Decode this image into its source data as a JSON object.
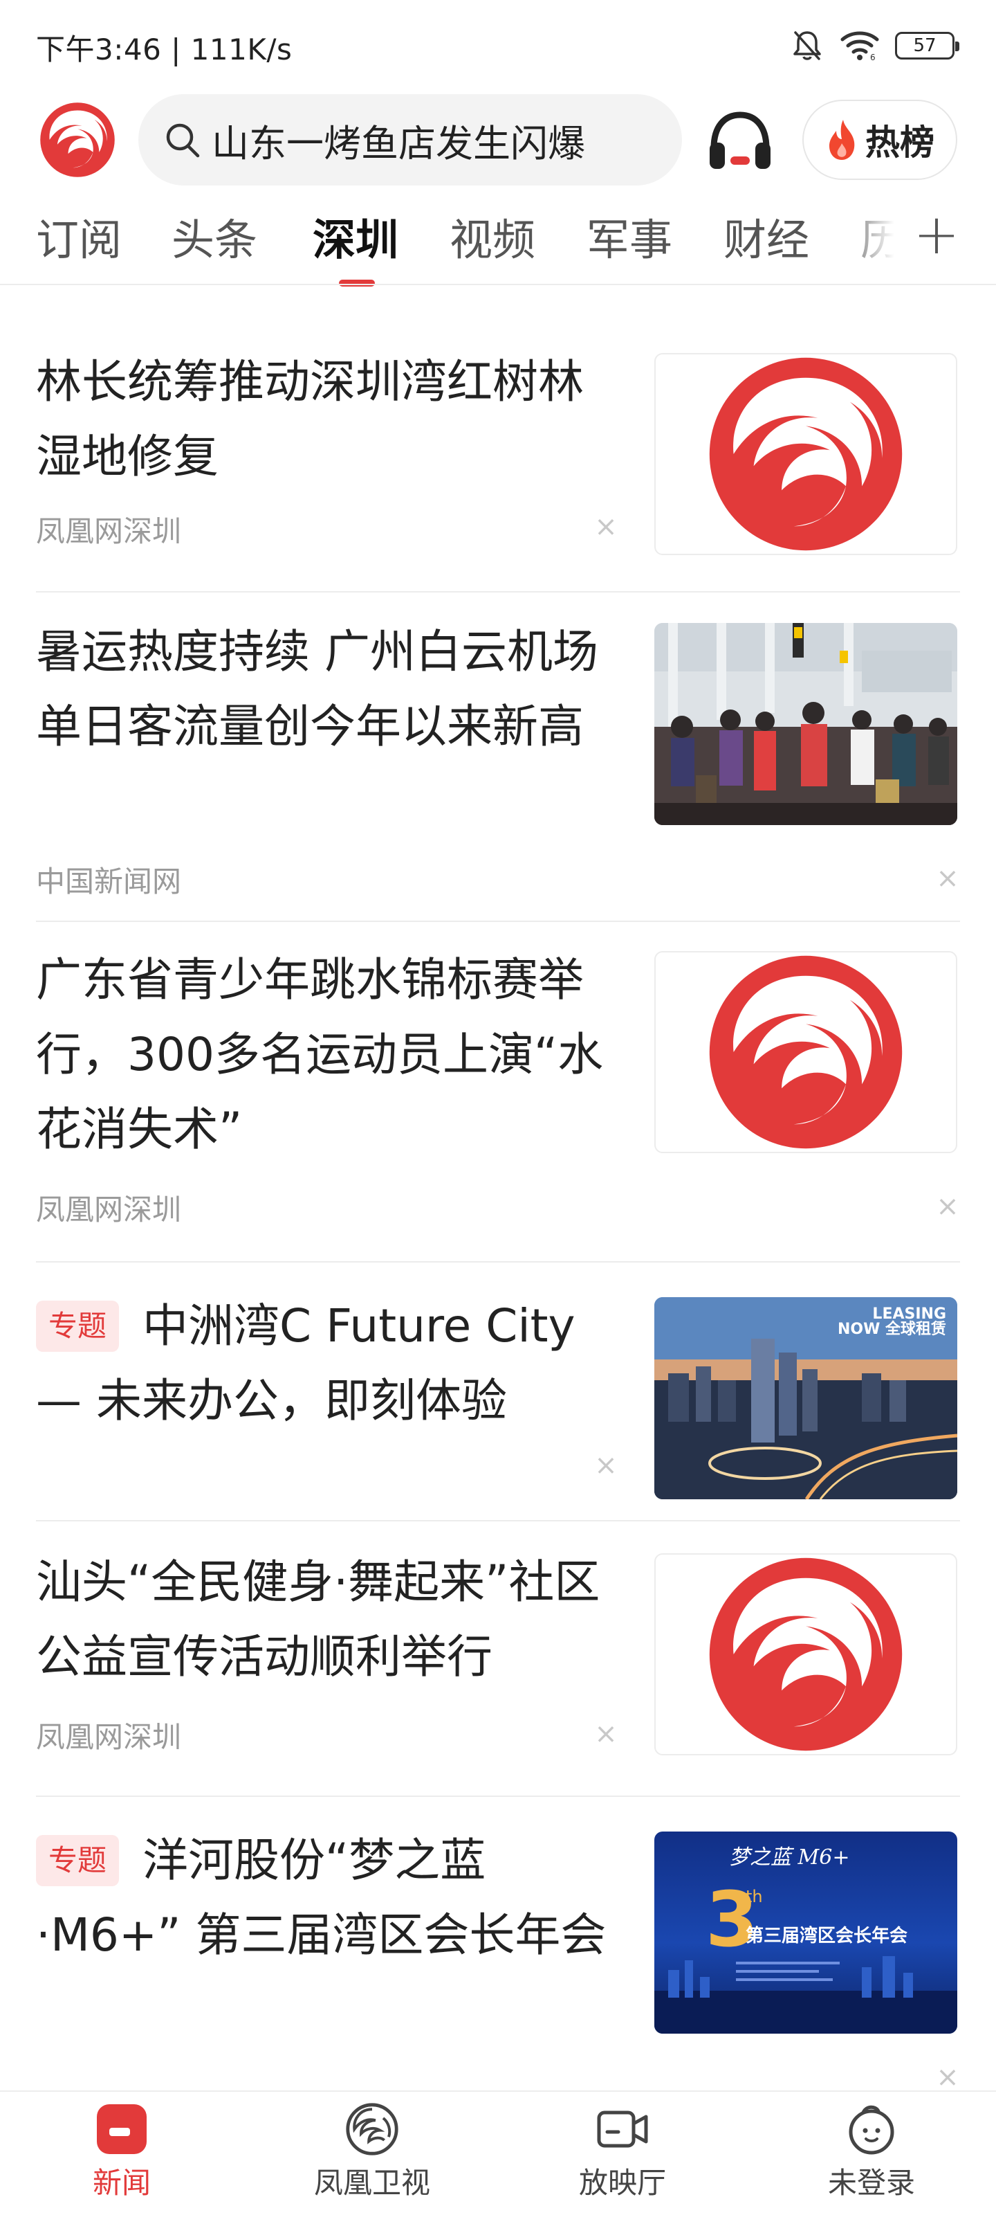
{
  "status_bar": {
    "time_and_speed": "下午3:46 | 111K/s",
    "battery_level": "57"
  },
  "header": {
    "logo_icon": "phoenix-logo-icon",
    "search_query": "山东一烤鱼店发生闪爆",
    "search_icon": "search-icon",
    "audio_icon": "headphones-icon",
    "hotlist_label": "热榜",
    "hotlist_icon": "flame-icon"
  },
  "tabs": {
    "items": [
      {
        "label": "订阅"
      },
      {
        "label": "头条"
      },
      {
        "label": "深圳"
      },
      {
        "label": "视频"
      },
      {
        "label": "军事"
      },
      {
        "label": "财经"
      },
      {
        "label": "历"
      }
    ],
    "active_label": "深圳",
    "add_label": "+"
  },
  "feed": {
    "items": [
      {
        "title": "林长统筹推动深圳湾红树林湿地修复",
        "source": "凤凰网深圳",
        "thumbnail": "phoenix-logo",
        "badge": ""
      },
      {
        "title": "暑运热度持续 广州白云机场单日客流量创今年以来新高",
        "source": "中国新闻网",
        "thumbnail": "airport-photo",
        "badge": ""
      },
      {
        "title": "广东省青少年跳水锦标赛举行，300多名运动员上演“水花消失术”",
        "source": "凤凰网深圳",
        "thumbnail": "phoenix-logo",
        "badge": ""
      },
      {
        "title": "中洲湾C Future City — 未来办公，即刻体验",
        "source": "",
        "thumbnail": "city-photo",
        "badge": "专题"
      },
      {
        "title": "汕头“全民健身·舞起来”社区公益宣传活动顺利举行",
        "source": "凤凰网深圳",
        "thumbnail": "phoenix-logo",
        "badge": ""
      },
      {
        "title": "洋河股份“梦之蓝·M6+” 第三届湾区会长年会",
        "source": "",
        "thumbnail": "conference-poster",
        "badge": "专题"
      }
    ],
    "close_label": "×"
  },
  "thumbnails": {
    "city": {
      "tag_line1": "LEASING",
      "tag_line2": "NOW 全球租赁"
    },
    "poster": {
      "brand": "梦之蓝 M6+",
      "number": "3",
      "ordinal": "th",
      "title": "第三届湾区会长年会"
    }
  },
  "bottom_nav": {
    "items": [
      {
        "label": "新闻",
        "icon": "news-icon"
      },
      {
        "label": "凤凰卫视",
        "icon": "phoenix-tv-icon"
      },
      {
        "label": "放映厅",
        "icon": "video-camera-icon"
      },
      {
        "label": "未登录",
        "icon": "profile-icon"
      }
    ]
  },
  "colors": {
    "accent_red": "#e23a3a",
    "badge_bg": "#fde8e8",
    "source_gray": "#9a9a9a"
  }
}
